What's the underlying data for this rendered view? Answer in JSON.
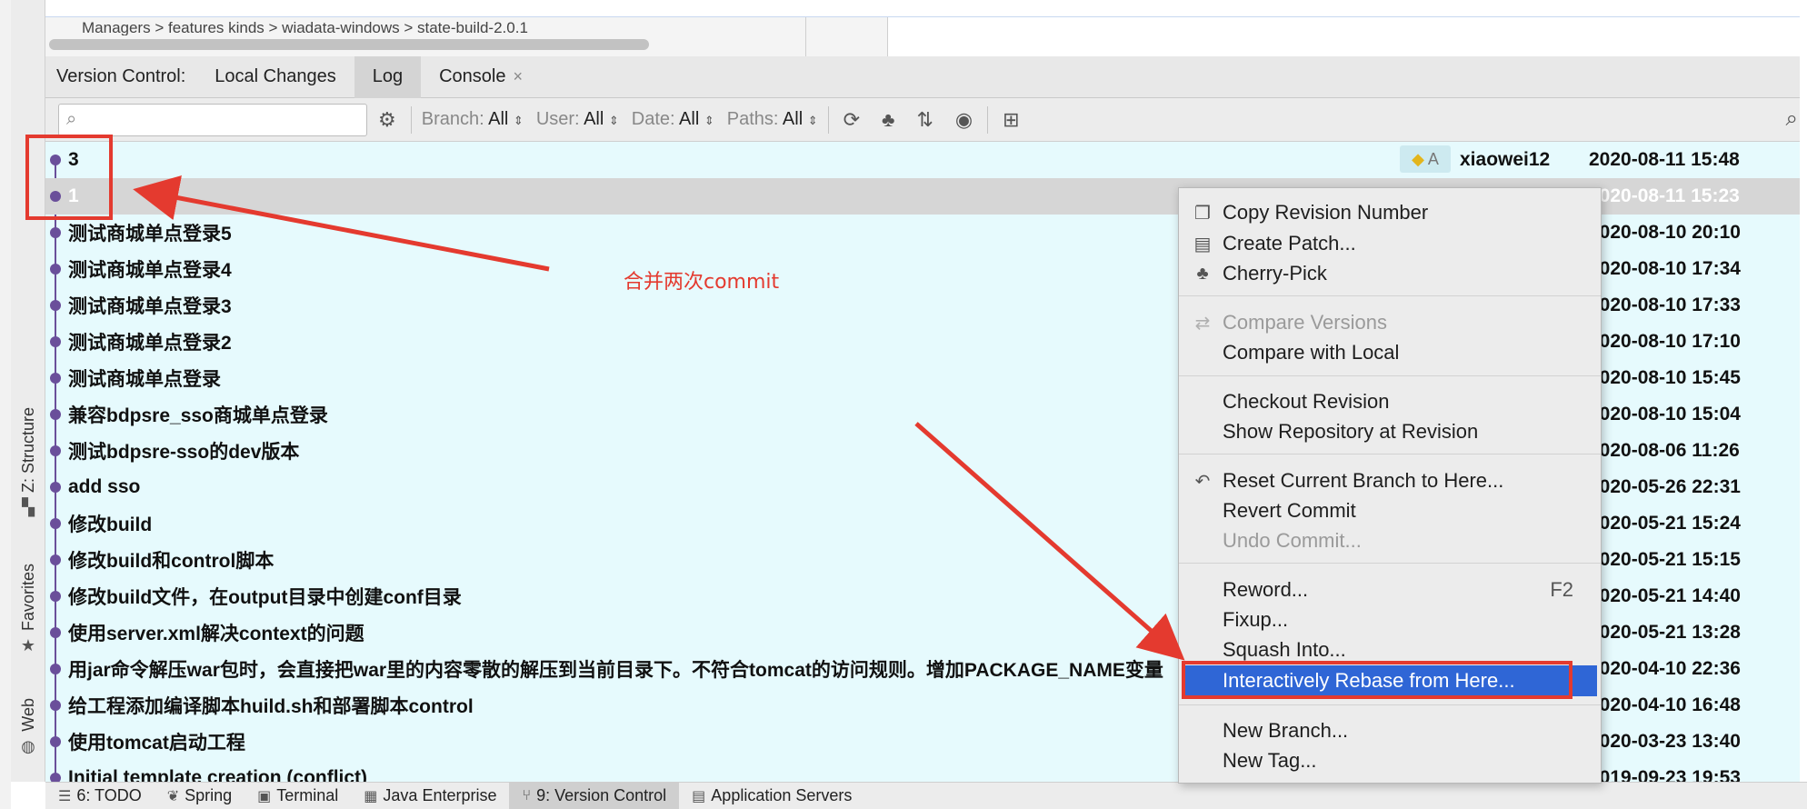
{
  "top": {
    "path_text": "Managers > features kinds > wiadata-windows > state-build-2.0.1"
  },
  "side_tabs": {
    "structure": "Z: Structure",
    "favorites": "Favorites",
    "web": "Web"
  },
  "tabs": {
    "prefix": "Version Control:",
    "items": [
      {
        "label": "Local Changes"
      },
      {
        "label": "Log"
      },
      {
        "label": "Console"
      }
    ],
    "close_glyph": "×"
  },
  "toolbar": {
    "search_placeholder": "",
    "filters": [
      {
        "name": "Branch:",
        "value": "All"
      },
      {
        "name": "User:",
        "value": "All"
      },
      {
        "name": "Date:",
        "value": "All"
      },
      {
        "name": "Paths:",
        "value": "All"
      }
    ]
  },
  "commits": [
    {
      "subject": "3",
      "tag": "A",
      "author": "xiaowei12",
      "date": "2020-08-11 15:48"
    },
    {
      "subject": "1",
      "date": "2020-08-11 15:23"
    },
    {
      "subject": "测试商城单点登录5",
      "date": "2020-08-10 20:10"
    },
    {
      "subject": "测试商城单点登录4",
      "date": "2020-08-10 17:34"
    },
    {
      "subject": "测试商城单点登录3",
      "date": "2020-08-10 17:33"
    },
    {
      "subject": "测试商城单点登录2",
      "date": "2020-08-10 17:10"
    },
    {
      "subject": "测试商城单点登录",
      "date": "2020-08-10 15:45"
    },
    {
      "subject": "兼容bdpsre_sso商城单点登录",
      "date": "2020-08-10 15:04"
    },
    {
      "subject": "测试bdpsre-sso的dev版本",
      "date": "2020-08-06 11:26"
    },
    {
      "subject": "add sso",
      "date": "2020-05-26 22:31"
    },
    {
      "subject": "修改build",
      "date": "2020-05-21 15:24"
    },
    {
      "subject": "修改build和control脚本",
      "date": "2020-05-21 15:15"
    },
    {
      "subject": "修改build文件，在output目录中创建conf目录",
      "date": "2020-05-21 14:40"
    },
    {
      "subject": "使用server.xml解决context的问题",
      "date": "2020-05-21 13:28"
    },
    {
      "subject": "用jar命令解压war包时，会直接把war里的内容零散的解压到当前目录下。不符合tomcat的访问规则。增加PACKAGE_NAME变量",
      "date": "2020-04-10 22:36"
    },
    {
      "subject": "给工程添加编译脚本huild.sh和部署脚本control",
      "date": "2020-04-10 16:48"
    },
    {
      "subject": "使用tomcat启动工程",
      "date": "2020-03-23 13:40"
    },
    {
      "subject": "Initial template creation (conflict)",
      "date": "2019-09-23 19:53"
    }
  ],
  "menu": {
    "copy_revision": "Copy Revision Number",
    "create_patch": "Create Patch...",
    "cherry_pick": "Cherry-Pick",
    "compare_versions": "Compare Versions",
    "compare_local": "Compare with Local",
    "checkout_revision": "Checkout Revision",
    "show_repo": "Show Repository at Revision",
    "reset_branch": "Reset Current Branch to Here...",
    "revert_commit": "Revert Commit",
    "undo_commit": "Undo Commit...",
    "reword": "Reword...",
    "reword_shortcut": "F2",
    "fixup": "Fixup...",
    "squash": "Squash Into...",
    "rebase": "Interactively Rebase from Here...",
    "new_branch": "New Branch...",
    "new_tag": "New Tag..."
  },
  "annotation": {
    "text": "合并两次commit",
    "color": "#e43a2f"
  },
  "bottom": {
    "items": [
      {
        "label": "6: TODO"
      },
      {
        "label": "Spring"
      },
      {
        "label": "Terminal"
      },
      {
        "label": "Java Enterprise"
      },
      {
        "label": "9: Version Control"
      },
      {
        "label": "Application Servers"
      }
    ]
  },
  "colors": {
    "log_bg": "#e6fafd",
    "graph": "#6a4f9a",
    "selected_row": "#d6d6d6",
    "menu_highlight": "#2f66d6"
  }
}
